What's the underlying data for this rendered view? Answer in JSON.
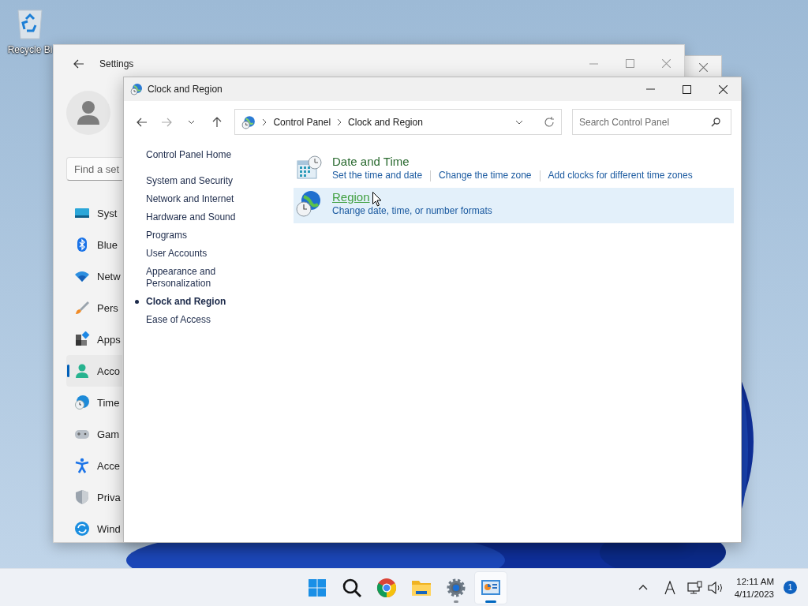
{
  "desktop": {
    "icons": [
      {
        "kind": "recycle-bin",
        "label": "Recycle Bi"
      }
    ]
  },
  "settings_window": {
    "title": "Settings",
    "search": {
      "placeholder": "Find a set"
    },
    "nav": [
      {
        "kind": "system",
        "label": "Syst",
        "selected": false
      },
      {
        "kind": "bluetooth",
        "label": "Blue",
        "selected": false
      },
      {
        "kind": "network",
        "label": "Netw",
        "selected": false
      },
      {
        "kind": "personalization",
        "label": "Pers",
        "selected": false
      },
      {
        "kind": "apps",
        "label": "Apps",
        "selected": false
      },
      {
        "kind": "accounts",
        "label": "Acco",
        "selected": true
      },
      {
        "kind": "time",
        "label": "Time",
        "selected": false
      },
      {
        "kind": "gaming",
        "label": "Gam",
        "selected": false
      },
      {
        "kind": "accessibility",
        "label": "Acce",
        "selected": false
      },
      {
        "kind": "privacy",
        "label": "Priva",
        "selected": false
      },
      {
        "kind": "update",
        "label": "Wind",
        "selected": false
      }
    ]
  },
  "control_panel": {
    "title": "Clock and Region",
    "breadcrumb": [
      "Control Panel",
      "Clock and Region"
    ],
    "search": {
      "placeholder": "Search Control Panel"
    },
    "sidebar": {
      "home": "Control Panel Home",
      "items": [
        {
          "label": "System and Security",
          "selected": false
        },
        {
          "label": "Network and Internet",
          "selected": false
        },
        {
          "label": "Hardware and Sound",
          "selected": false
        },
        {
          "label": "Programs",
          "selected": false
        },
        {
          "label": "User Accounts",
          "selected": false
        },
        {
          "label": "Appearance and Personalization",
          "selected": false
        },
        {
          "label": "Clock and Region",
          "selected": true
        },
        {
          "label": "Ease of Access",
          "selected": false
        }
      ]
    },
    "categories": [
      {
        "kind": "date-time",
        "title": "Date and Time",
        "hovered": false,
        "links": [
          "Set the time and date",
          "Change the time zone",
          "Add clocks for different time zones"
        ]
      },
      {
        "kind": "region",
        "title": "Region",
        "hovered": true,
        "links": [
          "Change date, time, or number formats"
        ]
      }
    ]
  },
  "taskbar": {
    "apps": [
      {
        "kind": "start",
        "running": false,
        "selected": false
      },
      {
        "kind": "search",
        "running": false,
        "selected": false
      },
      {
        "kind": "browser",
        "running": false,
        "selected": false
      },
      {
        "kind": "files",
        "running": false,
        "selected": false
      },
      {
        "kind": "settings",
        "running": true,
        "selected": false
      },
      {
        "kind": "control-panel",
        "running": true,
        "selected": true
      }
    ],
    "tray": {
      "time": "12:11 AM",
      "date": "4/11/2023",
      "notifications": "1"
    }
  }
}
